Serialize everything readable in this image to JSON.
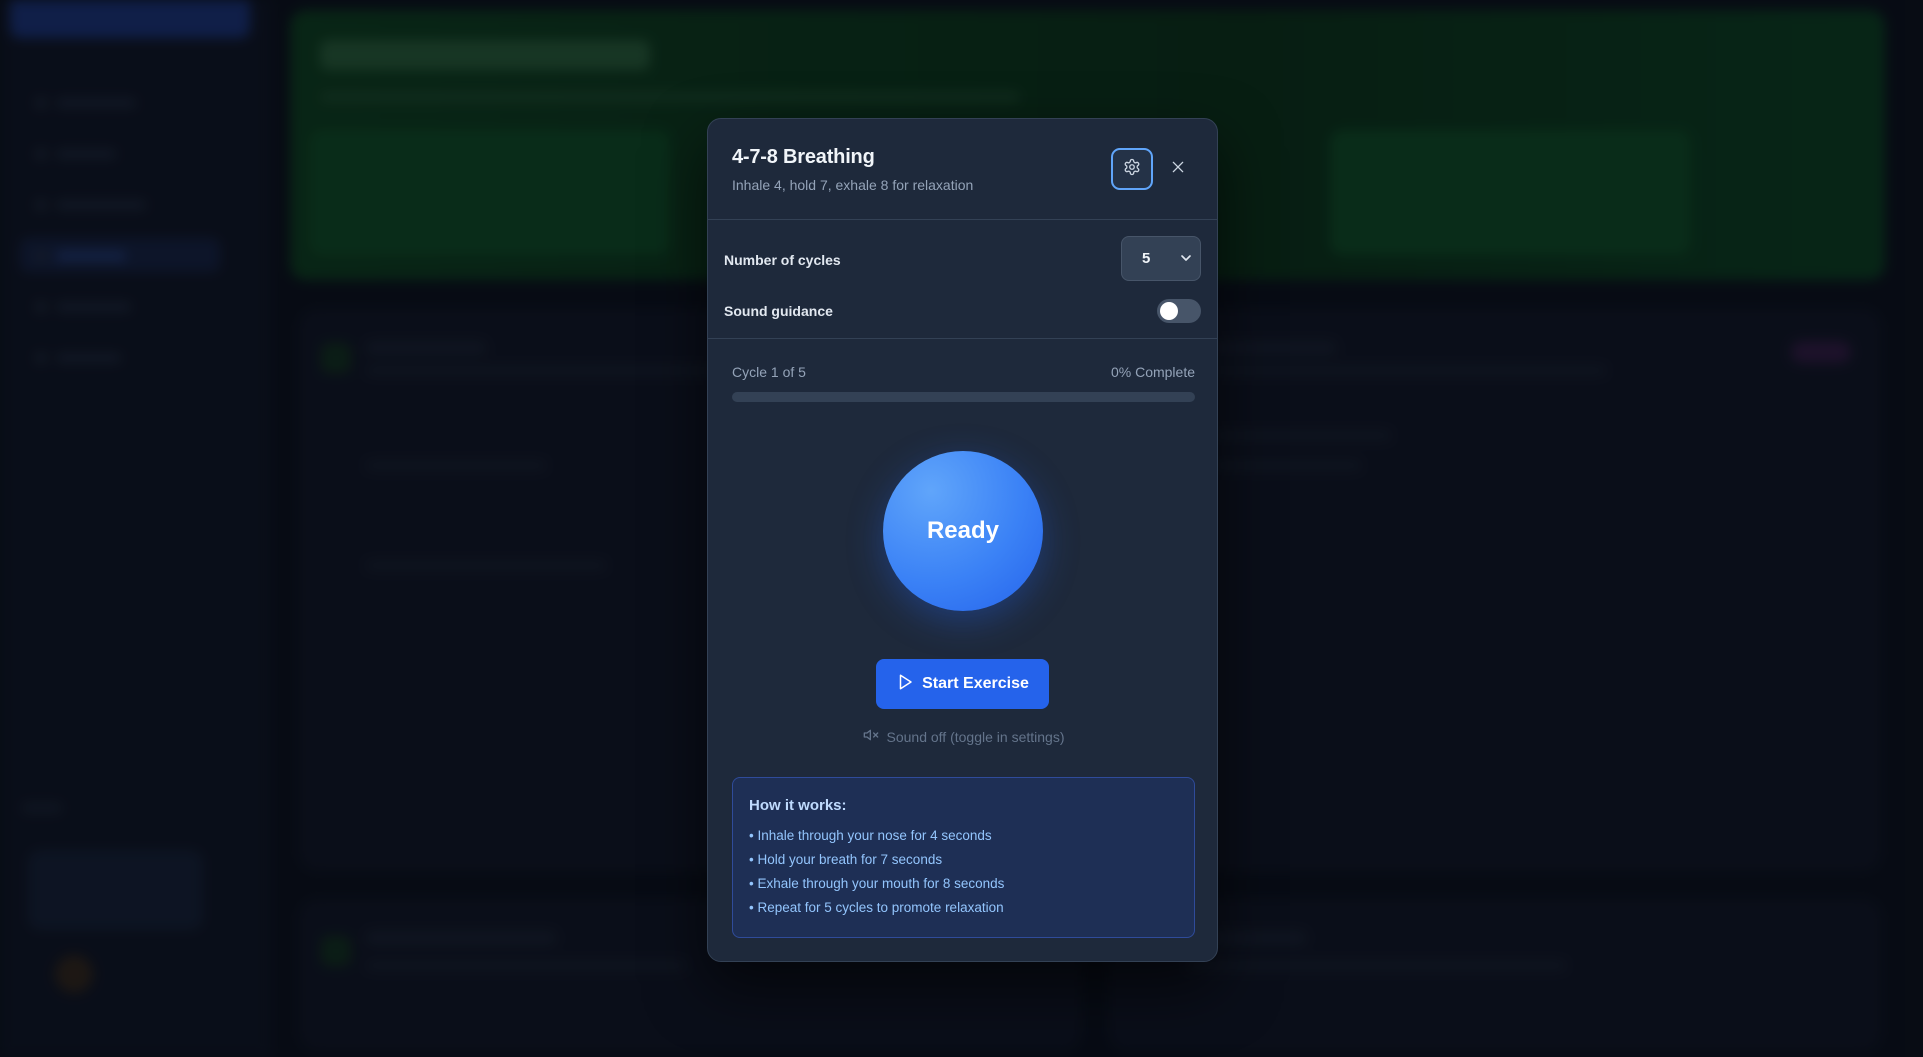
{
  "colors": {
    "modal_bg": "#1e293b",
    "accent": "#2563eb",
    "circle": "#3b82f6",
    "info_bg": "#1e2f55",
    "info_text": "#93c5fd"
  },
  "modal": {
    "title": "4-7-8 Breathing",
    "subtitle": "Inhale 4, hold 7, exhale 8 for relaxation",
    "settings_icon": "gear-icon",
    "close_icon": "close-icon"
  },
  "settings": {
    "cycles_label": "Number of cycles",
    "cycles_value": "5",
    "sound_label": "Sound guidance",
    "sound_enabled": false
  },
  "progress": {
    "cycle_text": "Cycle 1 of 5",
    "complete_text": "0% Complete",
    "fraction": 0
  },
  "circle": {
    "state": "Ready"
  },
  "start_button": {
    "label": "Start Exercise",
    "icon": "play-icon"
  },
  "sound_note": {
    "icon": "mute-icon",
    "text": "Sound off (toggle in settings)"
  },
  "how_it_works": {
    "title": "How it works:",
    "items": [
      "• Inhale through your nose for 4 seconds",
      "• Hold your breath for 7 seconds",
      "• Exhale through your mouth for 8 seconds",
      "• Repeat for 5 cycles to promote relaxation"
    ]
  }
}
